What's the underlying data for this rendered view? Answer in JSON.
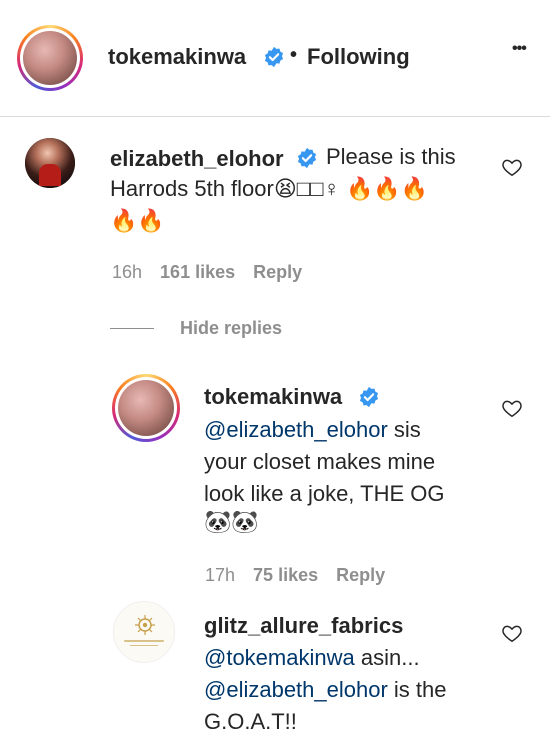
{
  "header": {
    "username": "tokemakinwa",
    "separator": "•",
    "follow_status": "Following",
    "more": "•••"
  },
  "comment": {
    "username": "elizabeth_elohor",
    "text_line1": "Please is this",
    "text_line2": "Harrods 5th floor😫□□♀ 🔥🔥🔥",
    "text_line3": "🔥🔥",
    "time": "16h",
    "likes": "161 likes",
    "reply": "Reply"
  },
  "replies_toggle": {
    "label": "Hide replies"
  },
  "replies": [
    {
      "username": "tokemakinwa",
      "mention": "@elizabeth_elohor",
      "text_a": "sis",
      "text_line2": "your closet makes mine",
      "text_line3": "look like a joke, THE OG",
      "text_line4": "🐼🐼",
      "time": "17h",
      "likes": "75 likes",
      "reply": "Reply"
    },
    {
      "username": "glitz_allure_fabrics",
      "mention1": "@tokemakinwa",
      "text_a": "asin...",
      "mention2": "@elizabeth_elohor",
      "text_b": "is the",
      "text_line3": "G.O.A.T!!"
    }
  ],
  "colors": {
    "text": "#262626",
    "secondary": "#8e8e8e",
    "mention": "#00376b",
    "verified": "#3897f0",
    "divider": "#dbdbdb"
  }
}
